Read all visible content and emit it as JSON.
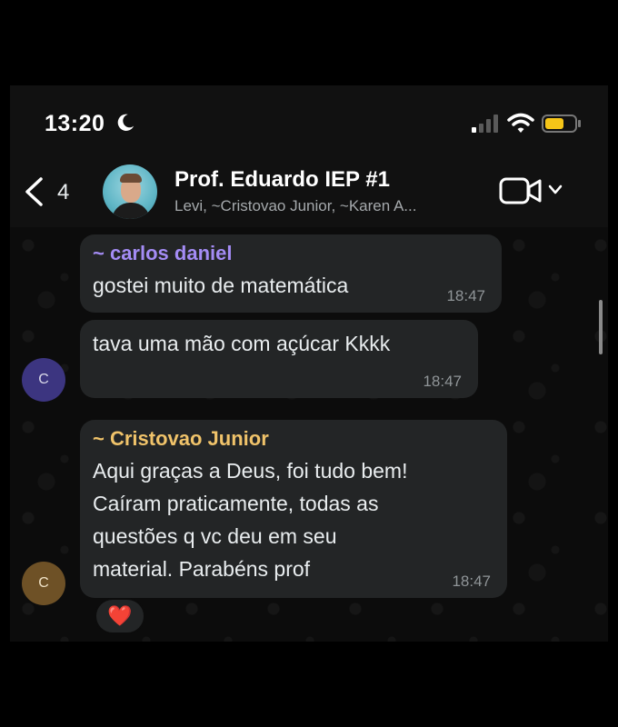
{
  "status_bar": {
    "time": "13:20",
    "focus_icon": "moon-icon",
    "battery_color": "#f5c518"
  },
  "header": {
    "back_count": "4",
    "title": "Prof. Eduardo IEP #1",
    "subtitle": "Levi, ~Cristovao Junior, ~Karen A..."
  },
  "messages": [
    {
      "sender": "~ carlos daniel",
      "sender_color": "#a48cf5",
      "text": "gostei muito de matemática",
      "time": "18:47"
    },
    {
      "sender": "",
      "text": "tava uma mão com açúcar Kkkk",
      "time": "18:47",
      "avatar_initial": "C"
    },
    {
      "sender": "~ Cristovao Junior",
      "sender_color": "#f0c36a",
      "text": "Aqui graças a Deus, foi tudo bem!\nCaíram praticamente, todas as\nquestões q vc deu em seu\nmaterial. Parabéns prof",
      "time": "18:47",
      "avatar_initial": "C",
      "reaction": "❤️"
    }
  ]
}
